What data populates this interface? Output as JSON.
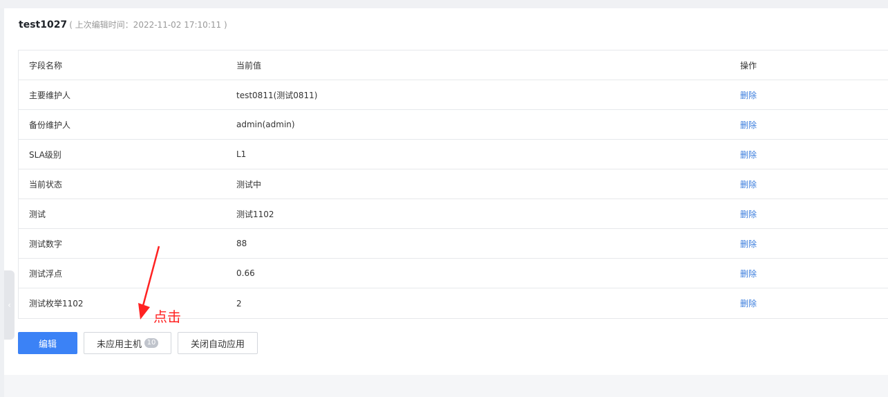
{
  "header": {
    "title": "test1027",
    "subtitle": "( 上次编辑时间：2022-11-02 17:10:11 )"
  },
  "table": {
    "columns": [
      "字段名称",
      "当前值",
      "操作"
    ],
    "rows": [
      {
        "field": "主要维护人",
        "value": "test0811(测试0811)",
        "action": "删除"
      },
      {
        "field": "备份维护人",
        "value": "admin(admin)",
        "action": "删除"
      },
      {
        "field": "SLA级别",
        "value": "L1",
        "action": "删除"
      },
      {
        "field": "当前状态",
        "value": "测试中",
        "action": "删除"
      },
      {
        "field": "测试",
        "value": "测试1102",
        "action": "删除"
      },
      {
        "field": "测试数字",
        "value": "88",
        "action": "删除"
      },
      {
        "field": "测试浮点",
        "value": "0.66",
        "action": "删除"
      },
      {
        "field": "测试枚举1102",
        "value": "2",
        "action": "删除"
      }
    ]
  },
  "buttons": {
    "edit": "编辑",
    "unapplied_hosts": "未应用主机",
    "unapplied_count": "10",
    "close_auto_apply": "关闭自动应用"
  },
  "annotation": {
    "text": "点击",
    "color": "#ff2222"
  },
  "colors": {
    "primary": "#3b82f6",
    "link": "#3b7ddd"
  },
  "icons": {
    "collapse": "chevron-left-icon"
  }
}
